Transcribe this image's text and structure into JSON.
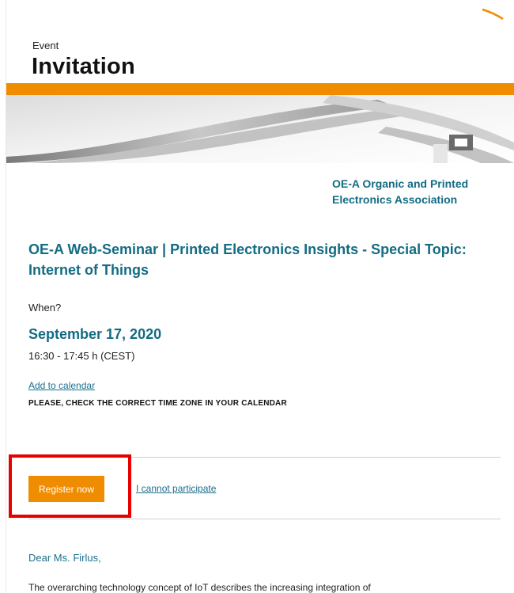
{
  "header": {
    "label": "Event",
    "title": "Invitation"
  },
  "organization": {
    "name": "OE-A Organic and Printed Electronics Association"
  },
  "seminar": {
    "title": "OE-A Web-Seminar | Printed Electronics Insights - Special Topic: Internet of Things"
  },
  "schedule": {
    "when_label": "When?",
    "date": "September 17, 2020",
    "time": "16:30 - 17:45 h (CEST)",
    "calendar_link": "Add to calendar",
    "timezone_note": "PLEASE, CHECK THE CORRECT TIME ZONE IN YOUR CALENDAR"
  },
  "actions": {
    "register_label": "Register now",
    "decline_label": "I cannot participate"
  },
  "letter": {
    "greeting": "Dear Ms. Firlus,",
    "intro": "The overarching technology concept of IoT describes the increasing integration of"
  },
  "colors": {
    "accent_orange": "#f08c00",
    "brand_teal": "#136c83",
    "highlight_red": "#e60000"
  }
}
